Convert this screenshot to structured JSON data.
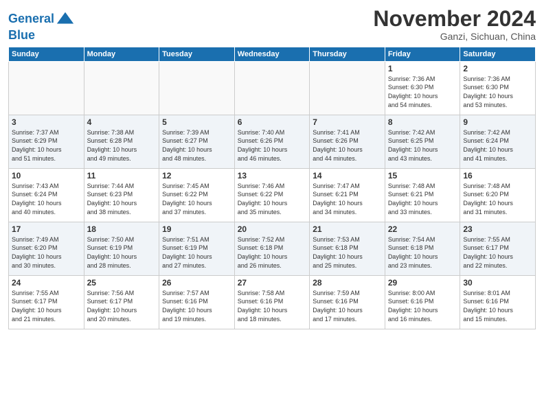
{
  "header": {
    "logo_line1": "General",
    "logo_line2": "Blue",
    "month_year": "November 2024",
    "location": "Ganzi, Sichuan, China"
  },
  "weekdays": [
    "Sunday",
    "Monday",
    "Tuesday",
    "Wednesday",
    "Thursday",
    "Friday",
    "Saturday"
  ],
  "weeks": [
    [
      {
        "day": "",
        "info": ""
      },
      {
        "day": "",
        "info": ""
      },
      {
        "day": "",
        "info": ""
      },
      {
        "day": "",
        "info": ""
      },
      {
        "day": "",
        "info": ""
      },
      {
        "day": "1",
        "info": "Sunrise: 7:36 AM\nSunset: 6:30 PM\nDaylight: 10 hours\nand 54 minutes."
      },
      {
        "day": "2",
        "info": "Sunrise: 7:36 AM\nSunset: 6:30 PM\nDaylight: 10 hours\nand 53 minutes."
      }
    ],
    [
      {
        "day": "3",
        "info": "Sunrise: 7:37 AM\nSunset: 6:29 PM\nDaylight: 10 hours\nand 51 minutes."
      },
      {
        "day": "4",
        "info": "Sunrise: 7:38 AM\nSunset: 6:28 PM\nDaylight: 10 hours\nand 49 minutes."
      },
      {
        "day": "5",
        "info": "Sunrise: 7:39 AM\nSunset: 6:27 PM\nDaylight: 10 hours\nand 48 minutes."
      },
      {
        "day": "6",
        "info": "Sunrise: 7:40 AM\nSunset: 6:26 PM\nDaylight: 10 hours\nand 46 minutes."
      },
      {
        "day": "7",
        "info": "Sunrise: 7:41 AM\nSunset: 6:26 PM\nDaylight: 10 hours\nand 44 minutes."
      },
      {
        "day": "8",
        "info": "Sunrise: 7:42 AM\nSunset: 6:25 PM\nDaylight: 10 hours\nand 43 minutes."
      },
      {
        "day": "9",
        "info": "Sunrise: 7:42 AM\nSunset: 6:24 PM\nDaylight: 10 hours\nand 41 minutes."
      }
    ],
    [
      {
        "day": "10",
        "info": "Sunrise: 7:43 AM\nSunset: 6:24 PM\nDaylight: 10 hours\nand 40 minutes."
      },
      {
        "day": "11",
        "info": "Sunrise: 7:44 AM\nSunset: 6:23 PM\nDaylight: 10 hours\nand 38 minutes."
      },
      {
        "day": "12",
        "info": "Sunrise: 7:45 AM\nSunset: 6:22 PM\nDaylight: 10 hours\nand 37 minutes."
      },
      {
        "day": "13",
        "info": "Sunrise: 7:46 AM\nSunset: 6:22 PM\nDaylight: 10 hours\nand 35 minutes."
      },
      {
        "day": "14",
        "info": "Sunrise: 7:47 AM\nSunset: 6:21 PM\nDaylight: 10 hours\nand 34 minutes."
      },
      {
        "day": "15",
        "info": "Sunrise: 7:48 AM\nSunset: 6:21 PM\nDaylight: 10 hours\nand 33 minutes."
      },
      {
        "day": "16",
        "info": "Sunrise: 7:48 AM\nSunset: 6:20 PM\nDaylight: 10 hours\nand 31 minutes."
      }
    ],
    [
      {
        "day": "17",
        "info": "Sunrise: 7:49 AM\nSunset: 6:20 PM\nDaylight: 10 hours\nand 30 minutes."
      },
      {
        "day": "18",
        "info": "Sunrise: 7:50 AM\nSunset: 6:19 PM\nDaylight: 10 hours\nand 28 minutes."
      },
      {
        "day": "19",
        "info": "Sunrise: 7:51 AM\nSunset: 6:19 PM\nDaylight: 10 hours\nand 27 minutes."
      },
      {
        "day": "20",
        "info": "Sunrise: 7:52 AM\nSunset: 6:18 PM\nDaylight: 10 hours\nand 26 minutes."
      },
      {
        "day": "21",
        "info": "Sunrise: 7:53 AM\nSunset: 6:18 PM\nDaylight: 10 hours\nand 25 minutes."
      },
      {
        "day": "22",
        "info": "Sunrise: 7:54 AM\nSunset: 6:18 PM\nDaylight: 10 hours\nand 23 minutes."
      },
      {
        "day": "23",
        "info": "Sunrise: 7:55 AM\nSunset: 6:17 PM\nDaylight: 10 hours\nand 22 minutes."
      }
    ],
    [
      {
        "day": "24",
        "info": "Sunrise: 7:55 AM\nSunset: 6:17 PM\nDaylight: 10 hours\nand 21 minutes."
      },
      {
        "day": "25",
        "info": "Sunrise: 7:56 AM\nSunset: 6:17 PM\nDaylight: 10 hours\nand 20 minutes."
      },
      {
        "day": "26",
        "info": "Sunrise: 7:57 AM\nSunset: 6:16 PM\nDaylight: 10 hours\nand 19 minutes."
      },
      {
        "day": "27",
        "info": "Sunrise: 7:58 AM\nSunset: 6:16 PM\nDaylight: 10 hours\nand 18 minutes."
      },
      {
        "day": "28",
        "info": "Sunrise: 7:59 AM\nSunset: 6:16 PM\nDaylight: 10 hours\nand 17 minutes."
      },
      {
        "day": "29",
        "info": "Sunrise: 8:00 AM\nSunset: 6:16 PM\nDaylight: 10 hours\nand 16 minutes."
      },
      {
        "day": "30",
        "info": "Sunrise: 8:01 AM\nSunset: 6:16 PM\nDaylight: 10 hours\nand 15 minutes."
      }
    ]
  ]
}
